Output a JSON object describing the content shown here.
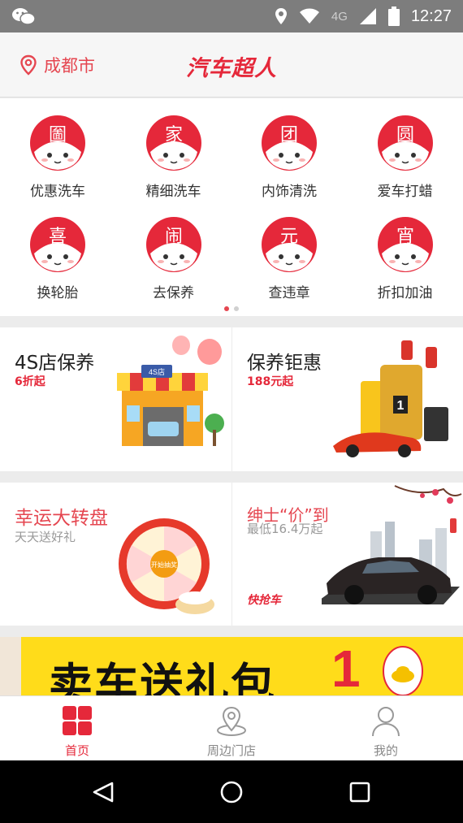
{
  "status_bar": {
    "network": "4G",
    "time": "12:27"
  },
  "header": {
    "location": "成都市",
    "title": "汽车超人"
  },
  "categories": [
    {
      "label": "优惠洗车",
      "glyph": "圗"
    },
    {
      "label": "精细洗车",
      "glyph": "家"
    },
    {
      "label": "内饰清洗",
      "glyph": "团"
    },
    {
      "label": "爱车打蜡",
      "glyph": "圆"
    },
    {
      "label": "换轮胎",
      "glyph": "喜"
    },
    {
      "label": "去保养",
      "glyph": "闹"
    },
    {
      "label": "查违章",
      "glyph": "元"
    },
    {
      "label": "折扣加油",
      "glyph": "宵"
    }
  ],
  "pager": {
    "pages": 2,
    "active": 1
  },
  "promos": [
    {
      "title": "4S店保养",
      "subtitle": "6折起",
      "shop_sign": "4S店"
    },
    {
      "title": "保养钜惠",
      "subtitle": "188元起",
      "bottle_label": "1"
    },
    {
      "title": "幸运大转盘",
      "subtitle": "天天送好礼",
      "wheel_text": "开始抽奖"
    },
    {
      "title": "绅士“价”到",
      "subtitle": "最低16.4万起",
      "brand": "快抢车"
    }
  ],
  "banner": {
    "text": "卖车送礼包",
    "number": "1"
  },
  "nav": [
    {
      "label": "首页",
      "active": true
    },
    {
      "label": "周边门店",
      "active": false
    },
    {
      "label": "我的",
      "active": false
    }
  ],
  "colors": {
    "brand_red": "#e5283a",
    "status_bar": "#7d7d7d",
    "banner_yellow": "#ffdc1a"
  }
}
